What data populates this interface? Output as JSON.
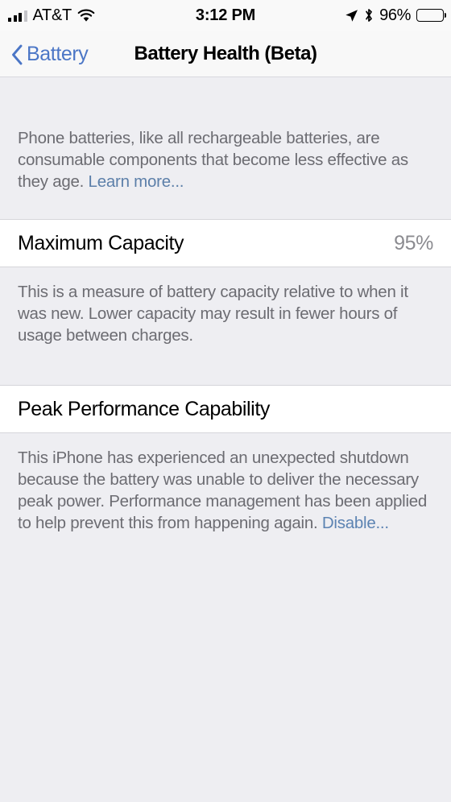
{
  "status_bar": {
    "carrier": "AT&T",
    "signal_icon": "cellular-signal-icon",
    "signal_bars_total": 4,
    "signal_bars_filled": 3,
    "wifi_icon": "wifi-icon",
    "time": "3:12 PM",
    "location_icon": "location-arrow-icon",
    "bluetooth_icon": "bluetooth-icon",
    "battery_percent": "96%",
    "battery_icon": "battery-full-icon"
  },
  "nav": {
    "back_icon": "chevron-left-icon",
    "back_label": "Battery",
    "title": "Battery Health (Beta)"
  },
  "intro": {
    "text": "Phone batteries, like all rechargeable batteries, are consumable components that become less effective as they age. ",
    "link": "Learn more..."
  },
  "maximum_capacity": {
    "title": "Maximum Capacity",
    "value": "95%",
    "note": "This is a measure of battery capacity relative to when it was new. Lower capacity may result in fewer hours of usage between charges."
  },
  "peak_performance": {
    "title": "Peak Performance Capability",
    "note": "This iPhone has experienced an unexpected shutdown because the battery was unable to deliver the necessary peak power. Performance management has been applied to help prevent this from happening again. ",
    "link": "Disable..."
  },
  "colors": {
    "accent_blue": "#4b76c6",
    "link_blue": "#5c7fa9",
    "group_background": "#eeeef2",
    "cell_background": "#ffffff",
    "secondary_text": "#6c6c72",
    "value_text": "#8b8b90"
  }
}
